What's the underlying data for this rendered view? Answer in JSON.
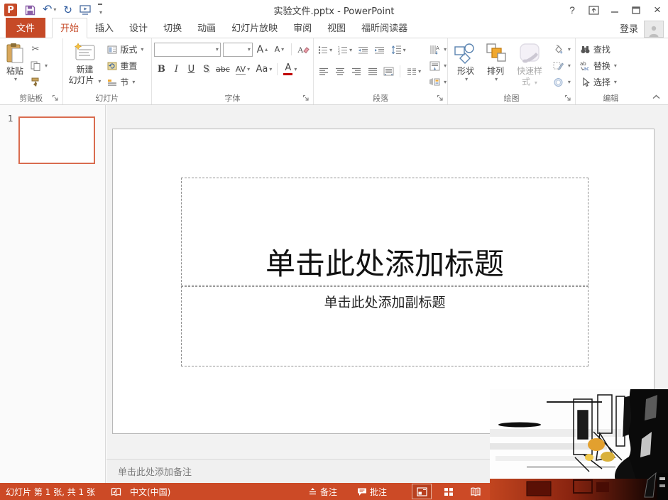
{
  "glyphs": {
    "caret": "▾",
    "caret_up": "▴",
    "scissors": "✂",
    "undo": "↶",
    "redo": "↻",
    "help": "?",
    "close": "×"
  },
  "colors": {
    "accent": "#C64A27",
    "status_bar": "#CC4A26",
    "selected_thumbnail_border": "#D96C4F",
    "save_icon": "#8A5FA8",
    "undo_icon": "#2F5B9E",
    "font_color_bar": "#C00000"
  },
  "title_bar": {
    "title": "实验文件.pptx - PowerPoint"
  },
  "tabs": {
    "file": "文件",
    "items": [
      "开始",
      "插入",
      "设计",
      "切换",
      "动画",
      "幻灯片放映",
      "审阅",
      "视图",
      "福昕阅读器"
    ],
    "selected": "开始",
    "sign_in": "登录"
  },
  "ribbon": {
    "clipboard": {
      "label": "剪贴板",
      "paste": "粘贴"
    },
    "slides": {
      "label": "幻灯片",
      "new_slide_l1": "新建",
      "new_slide_l2": "幻灯片",
      "layout": "版式",
      "reset": "重置",
      "section": "节"
    },
    "font": {
      "label": "字体",
      "bold": "B",
      "italic": "I",
      "underline": "U",
      "shadow": "S",
      "strike": "abc",
      "spacing": "AV",
      "case_btn": "Aa",
      "color_btn": "A",
      "grow": "A",
      "shrink": "A"
    },
    "paragraph": {
      "label": "段落"
    },
    "drawing": {
      "label": "绘图",
      "shapes": "形状",
      "arrange": "排列",
      "quick_styles": "快速样式"
    },
    "editing": {
      "label": "编辑",
      "find": "查找",
      "replace": "替换",
      "select": "选择"
    }
  },
  "slides_panel": {
    "slide_number": "1"
  },
  "slide": {
    "title_placeholder": "单击此处添加标题",
    "subtitle_placeholder": "单击此处添加副标题"
  },
  "notes": {
    "placeholder": "单击此处添加备注"
  },
  "status_bar": {
    "slide_info": "幻灯片 第 1 张, 共 1 张",
    "language": "中文(中国)",
    "notes_btn": "备注",
    "comments_btn": "批注"
  }
}
